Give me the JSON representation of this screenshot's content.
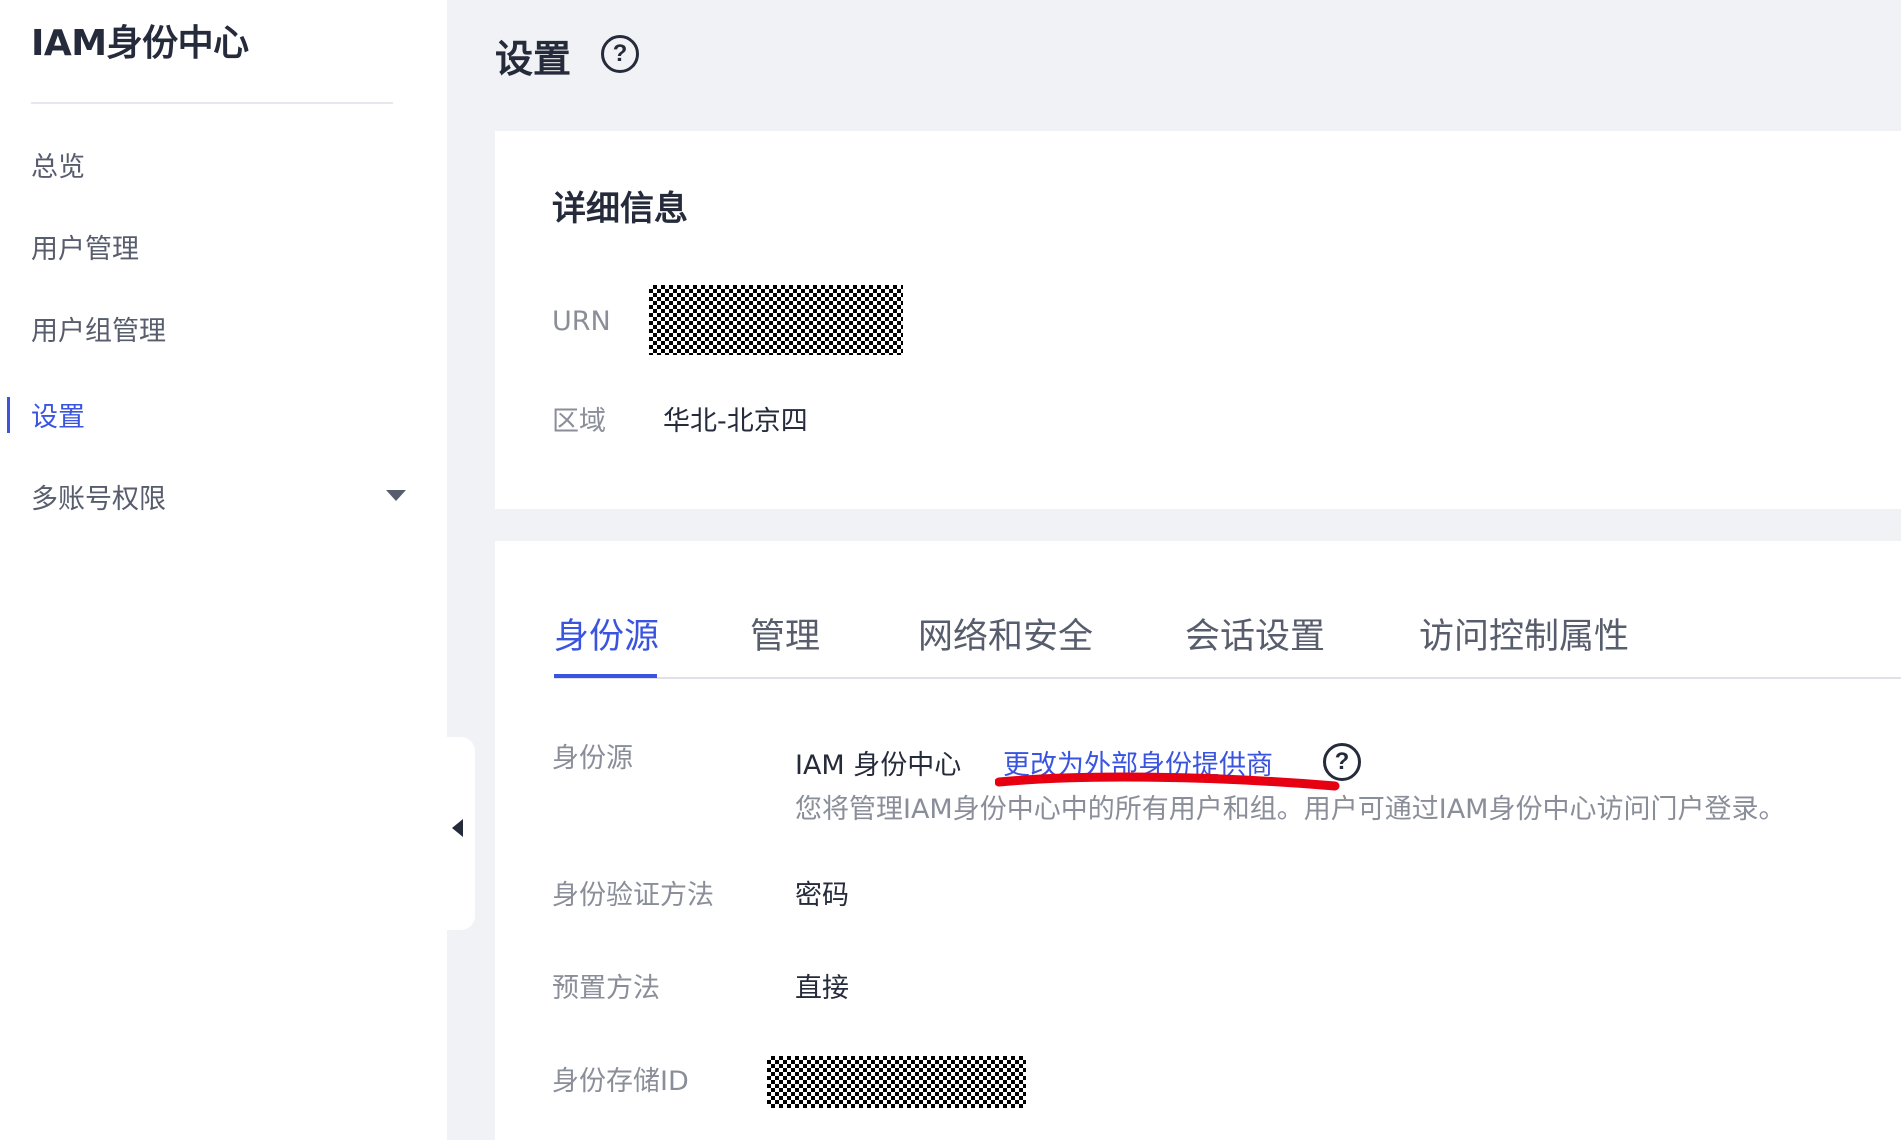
{
  "sidebar": {
    "title": "IAM身份中心",
    "items": [
      {
        "label": "总览"
      },
      {
        "label": "用户管理"
      },
      {
        "label": "用户组管理"
      },
      {
        "label": "设置"
      },
      {
        "label": "多账号权限"
      }
    ]
  },
  "page": {
    "title": "设置",
    "help_glyph": "?"
  },
  "details": {
    "title": "详细信息",
    "urn_label": "URN",
    "region_label": "区域",
    "region_value": "华北-北京四"
  },
  "tabs": [
    {
      "label": "身份源"
    },
    {
      "label": "管理"
    },
    {
      "label": "网络和安全"
    },
    {
      "label": "会话设置"
    },
    {
      "label": "访问控制属性"
    }
  ],
  "identity_source": {
    "source_label": "身份源",
    "source_value": "IAM 身份中心",
    "change_link": "更改为外部身份提供商",
    "help_glyph": "?",
    "description": "您将管理IAM身份中心中的所有用户和组。用户可通过IAM身份中心访问门户登录。",
    "auth_label": "身份验证方法",
    "auth_value": "密码",
    "provision_label": "预置方法",
    "provision_value": "直接",
    "store_label": "身份存储ID"
  },
  "colors": {
    "accent": "#3a54e0",
    "annotation": "#e60012"
  }
}
